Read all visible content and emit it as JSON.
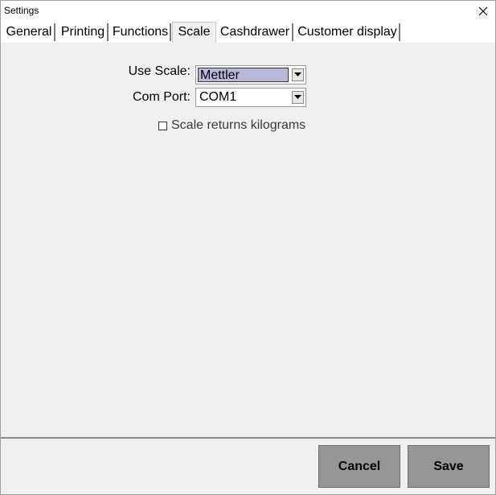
{
  "window": {
    "title": "Settings"
  },
  "tabs": [
    {
      "label": "General"
    },
    {
      "label": "Printing"
    },
    {
      "label": "Functions"
    },
    {
      "label": "Scale"
    },
    {
      "label": "Cashdrawer"
    },
    {
      "label": "Customer display"
    }
  ],
  "active_tab": "Scale",
  "scale": {
    "use_scale_label": "Use Scale:",
    "use_scale_value": "Mettler",
    "com_port_label": "Com Port:",
    "com_port_value": "COM1",
    "kilograms_label": "Scale returns kilograms",
    "kilograms_checked": false
  },
  "footer": {
    "cancel_label": "Cancel",
    "save_label": "Save"
  },
  "icons": {
    "close": "close-icon",
    "dropdown": "triangle-down-icon"
  }
}
